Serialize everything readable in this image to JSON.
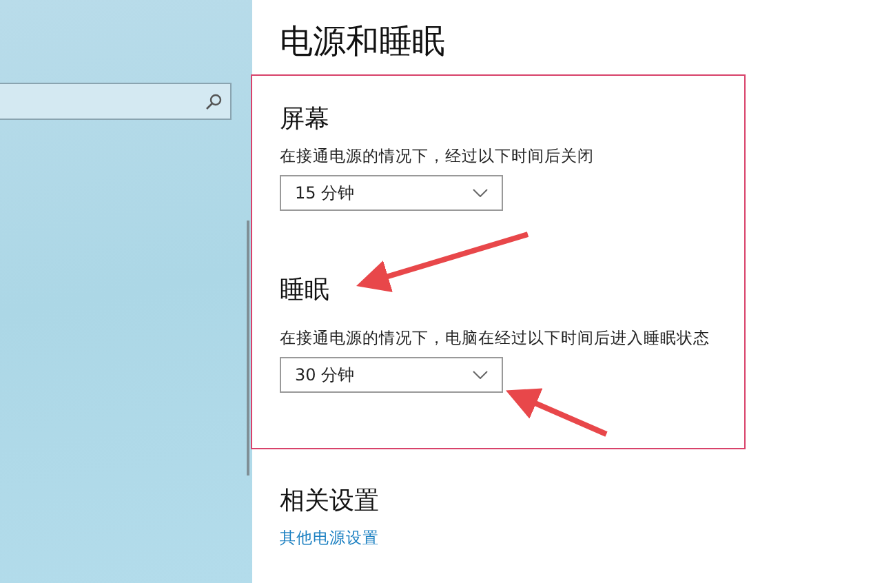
{
  "title": "电源和睡眠",
  "sections": [
    {
      "heading": "屏幕",
      "description": "在接通电源的情况下，经过以下时间后关闭",
      "dropdown": "15 分钟"
    },
    {
      "heading": "睡眠",
      "description": "在接通电源的情况下，电脑在经过以下时间后进入睡眠状态",
      "dropdown": "30 分钟"
    }
  ],
  "related": {
    "heading": "相关设置",
    "link": "其他电源设置"
  }
}
